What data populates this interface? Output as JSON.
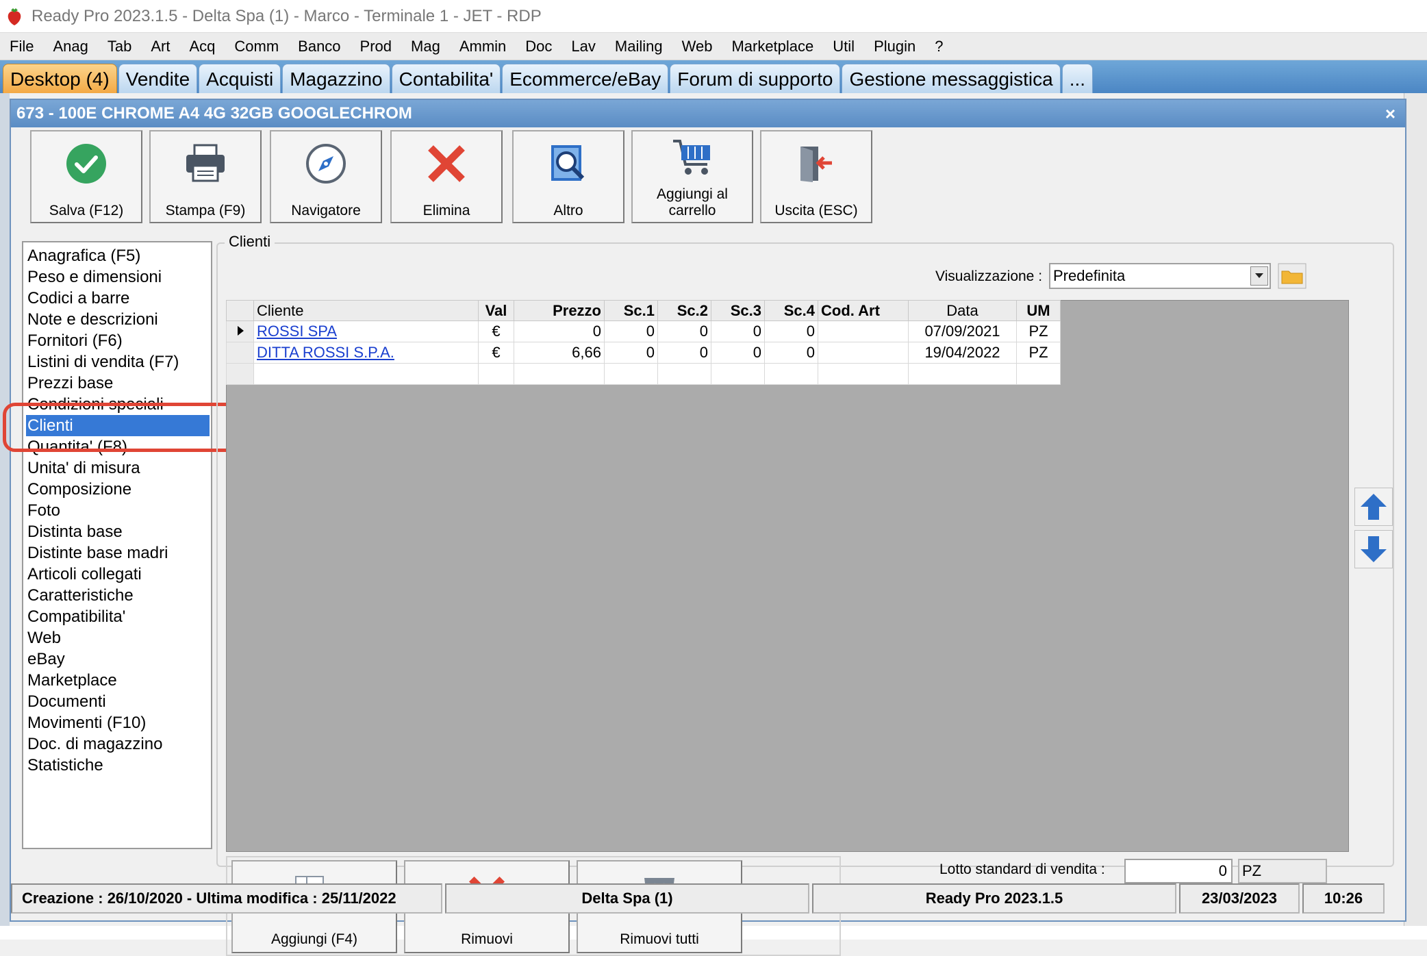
{
  "app": {
    "title": "Ready Pro 2023.1.5 - Delta Spa (1) - Marco - Terminale 1 - JET - RDP"
  },
  "menu": [
    "File",
    "Anag",
    "Tab",
    "Art",
    "Acq",
    "Comm",
    "Banco",
    "Prod",
    "Mag",
    "Ammin",
    "Doc",
    "Lav",
    "Mailing",
    "Web",
    "Marketplace",
    "Util",
    "Plugin",
    "?"
  ],
  "tabs": [
    {
      "label": "Desktop (4)",
      "active": true
    },
    {
      "label": "Vendite"
    },
    {
      "label": "Acquisti"
    },
    {
      "label": "Magazzino"
    },
    {
      "label": "Contabilita'"
    },
    {
      "label": "Ecommerce/eBay"
    },
    {
      "label": "Forum di supporto"
    },
    {
      "label": "Gestione messaggistica"
    },
    {
      "label": "..."
    }
  ],
  "window": {
    "title": "673 - 100E CHROME A4 4G 32GB GOOGLECHROM",
    "close_label": "×"
  },
  "toolbar": {
    "save_label": "Salva (F12)",
    "print_label": "Stampa (F9)",
    "navigator_label": "Navigatore",
    "delete_label": "Elimina",
    "other_label": "Altro",
    "cart_label_line1": "Aggiungi al",
    "cart_label_line2": "carrello",
    "exit_label": "Uscita (ESC)"
  },
  "sidenav": {
    "items": [
      "Anagrafica (F5)",
      "Peso e dimensioni",
      "Codici a barre",
      "Note e descrizioni",
      "Fornitori (F6)",
      "Listini di vendita (F7)",
      "Prezzi base",
      "Condizioni speciali",
      "Clienti",
      "Quantita' (F8)",
      "Unita' di misura",
      "Composizione",
      "Foto",
      "Distinta base",
      "Distinte base madri",
      "Articoli collegati",
      "Caratteristiche",
      "Compatibilita'",
      "Web",
      "eBay",
      "Marketplace",
      "Documenti",
      "Movimenti (F10)",
      "Doc. di magazzino",
      "Statistiche"
    ],
    "selected_index": 8
  },
  "clienti": {
    "group_label": "Clienti",
    "visualizzazione_label": "Visualizzazione :",
    "visualizzazione_value": "Predefinita",
    "columns": [
      "Cliente",
      "Val",
      "Prezzo",
      "Sc.1",
      "Sc.2",
      "Sc.3",
      "Sc.4",
      "Cod. Art",
      "Data",
      "UM"
    ],
    "rows": [
      [
        "ROSSI SPA",
        "€",
        "0",
        "0",
        "0",
        "0",
        "0",
        "",
        "07/09/2021",
        "PZ"
      ],
      [
        "DITTA ROSSI S.P.A.",
        "€",
        "6,66",
        "0",
        "0",
        "0",
        "0",
        "",
        "19/04/2022",
        "PZ"
      ]
    ]
  },
  "actions": {
    "add_label": "Aggiungi (F4)",
    "remove_label": "Rimuovi",
    "remove_all_label": "Rimuovi tutti"
  },
  "lotto": {
    "label": "Lotto standard di vendita :",
    "value": "0",
    "um": "PZ"
  },
  "status": {
    "creation": "Creazione : 26/10/2020 - Ultima modifica : 25/11/2022",
    "company": "Delta Spa (1)",
    "version": "Ready Pro 2023.1.5",
    "date": "23/03/2023",
    "time": "10:26"
  },
  "colors": {
    "accent_blue": "#3679d6",
    "highlight_red": "#e04535",
    "link_blue": "#1a3fcf"
  }
}
